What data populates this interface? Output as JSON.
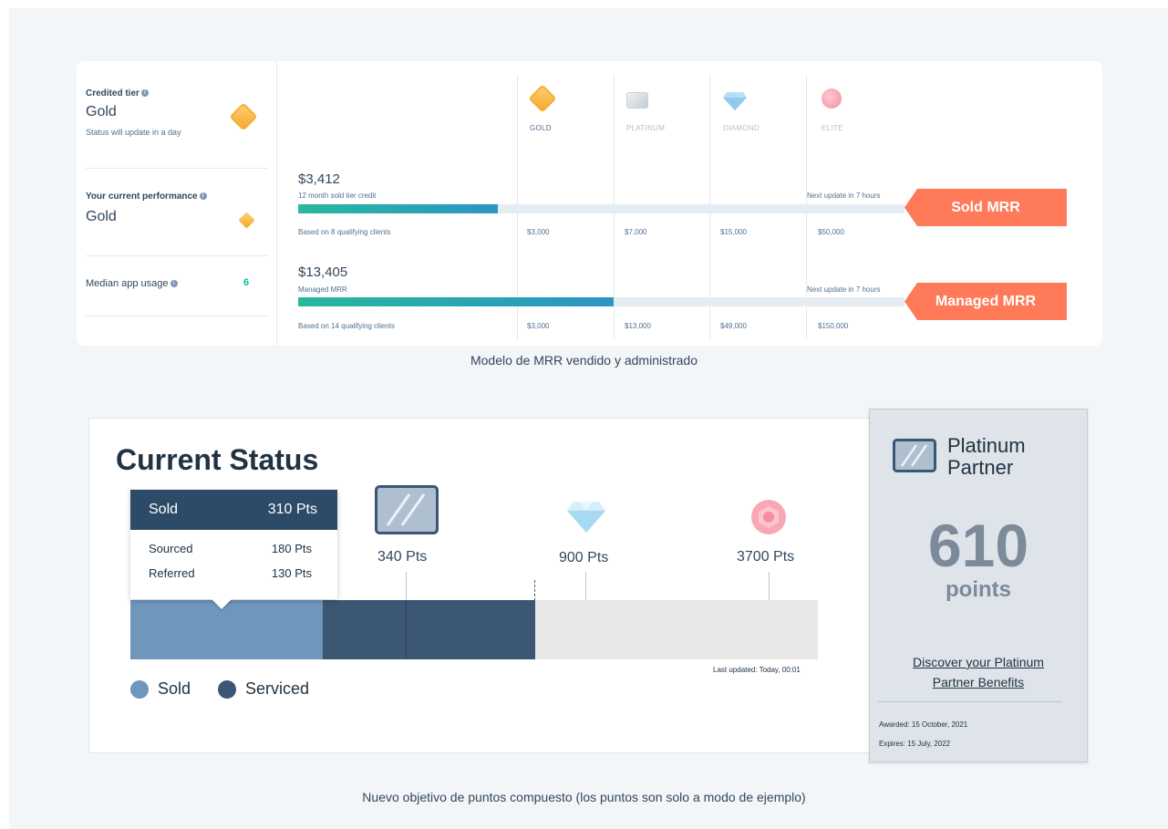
{
  "top_section": {
    "left_column": {
      "credited_tier": {
        "label": "Credited tier",
        "value": "Gold",
        "note": "Status will update in a day"
      },
      "current_performance": {
        "label": "Your current performance",
        "value": "Gold"
      },
      "median_app_usage": {
        "label": "Median app usage",
        "value": "6"
      }
    },
    "tiers": [
      {
        "name": "GOLD",
        "icon": "gold-gem-icon"
      },
      {
        "name": "PLATINUM",
        "icon": "platinum-card-icon"
      },
      {
        "name": "DIAMOND",
        "icon": "diamond-icon"
      },
      {
        "name": "ELITE",
        "icon": "elite-gem-icon"
      }
    ],
    "sold_mrr": {
      "amount": "$3,412",
      "sublabel": "12 month sold tier credit",
      "progress": 0.33,
      "next_update": "Next update in 7 hours",
      "ribbon": "Sold MRR",
      "based_on": "Based on 8 qualifying clients",
      "thresholds": [
        "$3,000",
        "$7,000",
        "$15,000",
        "$50,000"
      ]
    },
    "managed_mrr": {
      "amount": "$13,405",
      "sublabel": "Managed MRR",
      "progress": 0.52,
      "next_update": "Next update in 7 hours",
      "ribbon": "Managed MRR",
      "based_on": "Based on 14 qualifying clients",
      "thresholds": [
        "$3,000",
        "$13,000",
        "$49,000",
        "$150,000"
      ]
    },
    "caption": "Modelo de MRR vendido y administrado"
  },
  "bottom_section": {
    "title": "Current Status",
    "tooltip": {
      "header_label": "Sold",
      "header_value": "310 Pts",
      "rows": [
        {
          "label": "Sourced",
          "value": "180 Pts"
        },
        {
          "label": "Referred",
          "value": "130 Pts"
        }
      ]
    },
    "milestones": [
      {
        "label": "340 Pts",
        "icon": "platinum-card-icon"
      },
      {
        "label": "900 Pts",
        "icon": "diamond-icon"
      },
      {
        "label": "3700 Pts",
        "icon": "elite-gem-icon"
      }
    ],
    "progress": {
      "sold_points": 310,
      "serviced_points": 300,
      "total_points": 610
    },
    "last_updated": "Last updated: Today, 00:01",
    "legend": [
      {
        "label": "Sold",
        "color": "#6f96bb"
      },
      {
        "label": "Serviced",
        "color": "#3b5773"
      }
    ],
    "partner_card": {
      "title_line1": "Platinum",
      "title_line2": "Partner",
      "points": "610",
      "points_label": "points",
      "link_line1": "Discover your Platinum",
      "link_line2": "Partner Benefits",
      "awarded": "Awarded: 15 October, 2021",
      "expires": "Expires: 15 July, 2022"
    },
    "caption": "Nuevo objetivo de puntos compuesto (los puntos son solo a modo de ejemplo)"
  },
  "colors": {
    "accent": "#ff7a59",
    "teal": "#27b89d",
    "navy": "#2d4a66"
  }
}
